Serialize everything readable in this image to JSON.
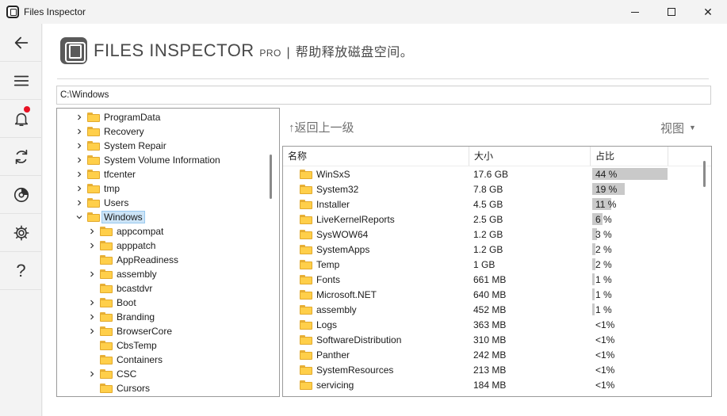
{
  "window": {
    "title": "Files Inspector",
    "buttons": {
      "minimize": "minimize-icon",
      "maximize": "maximize-icon",
      "close": "✕"
    }
  },
  "sidebar": {
    "items": [
      {
        "name": "back",
        "icon": "arrow-left-icon"
      },
      {
        "name": "menu",
        "icon": "hamburger-icon"
      },
      {
        "name": "notifications",
        "icon": "bell-icon",
        "has_badge": true
      },
      {
        "name": "refresh",
        "icon": "refresh-icon"
      },
      {
        "name": "disk",
        "icon": "disk-icon"
      },
      {
        "name": "settings",
        "icon": "gear-icon"
      },
      {
        "name": "help",
        "icon": "question-icon",
        "label": "?"
      }
    ]
  },
  "brand": {
    "name": "FILES INSPECTOR",
    "edition": "PRO",
    "separator": "|",
    "tagline": "帮助释放磁盘空间。"
  },
  "path": {
    "value": "C:\\Windows"
  },
  "tree": {
    "items": [
      {
        "label": "ProgramData",
        "level": 0,
        "expandable": true
      },
      {
        "label": "Recovery",
        "level": 0,
        "expandable": true
      },
      {
        "label": "System Repair",
        "level": 0,
        "expandable": true
      },
      {
        "label": "System Volume Information",
        "level": 0,
        "expandable": true
      },
      {
        "label": "tfcenter",
        "level": 0,
        "expandable": true
      },
      {
        "label": "tmp",
        "level": 0,
        "expandable": true
      },
      {
        "label": "Users",
        "level": 0,
        "expandable": true
      },
      {
        "label": "Windows",
        "level": 0,
        "expandable": true,
        "expanded": true,
        "selected": true
      },
      {
        "label": "appcompat",
        "level": 1,
        "expandable": true
      },
      {
        "label": "apppatch",
        "level": 1,
        "expandable": true
      },
      {
        "label": "AppReadiness",
        "level": 1,
        "expandable": false
      },
      {
        "label": "assembly",
        "level": 1,
        "expandable": true
      },
      {
        "label": "bcastdvr",
        "level": 1,
        "expandable": false
      },
      {
        "label": "Boot",
        "level": 1,
        "expandable": true
      },
      {
        "label": "Branding",
        "level": 1,
        "expandable": true
      },
      {
        "label": "BrowserCore",
        "level": 1,
        "expandable": true
      },
      {
        "label": "CbsTemp",
        "level": 1,
        "expandable": false
      },
      {
        "label": "Containers",
        "level": 1,
        "expandable": false
      },
      {
        "label": "CSC",
        "level": 1,
        "expandable": true
      },
      {
        "label": "Cursors",
        "level": 1,
        "expandable": false
      }
    ]
  },
  "panel": {
    "back_label": "↑返回上一级",
    "view_label": "视图",
    "view_caret": "▼"
  },
  "list": {
    "columns": {
      "name": "名称",
      "size": "大小",
      "share": "占比"
    },
    "rows": [
      {
        "name": "WinSxS",
        "size": "17.6 GB",
        "share": "44 %",
        "share_value": 0.44
      },
      {
        "name": "System32",
        "size": "7.8 GB",
        "share": "19 %",
        "share_value": 0.19
      },
      {
        "name": "Installer",
        "size": "4.5 GB",
        "share": "11 %",
        "share_value": 0.11
      },
      {
        "name": "LiveKernelReports",
        "size": "2.5 GB",
        "share": "6 %",
        "share_value": 0.06
      },
      {
        "name": "SysWOW64",
        "size": "1.2 GB",
        "share": "3 %",
        "share_value": 0.03
      },
      {
        "name": "SystemApps",
        "size": "1.2 GB",
        "share": "2 %",
        "share_value": 0.02
      },
      {
        "name": "Temp",
        "size": "1 GB",
        "share": "2 %",
        "share_value": 0.02
      },
      {
        "name": "Fonts",
        "size": "661 MB",
        "share": "1 %",
        "share_value": 0.01
      },
      {
        "name": "Microsoft.NET",
        "size": "640 MB",
        "share": "1 %",
        "share_value": 0.01
      },
      {
        "name": "assembly",
        "size": "452 MB",
        "share": "1 %",
        "share_value": 0.01
      },
      {
        "name": "Logs",
        "size": "363 MB",
        "share": "<1%",
        "share_value": 0
      },
      {
        "name": "SoftwareDistribution",
        "size": "310 MB",
        "share": "<1%",
        "share_value": 0
      },
      {
        "name": "Panther",
        "size": "242 MB",
        "share": "<1%",
        "share_value": 0
      },
      {
        "name": "SystemResources",
        "size": "213 MB",
        "share": "<1%",
        "share_value": 0
      },
      {
        "name": "servicing",
        "size": "184 MB",
        "share": "<1%",
        "share_value": 0
      }
    ]
  }
}
